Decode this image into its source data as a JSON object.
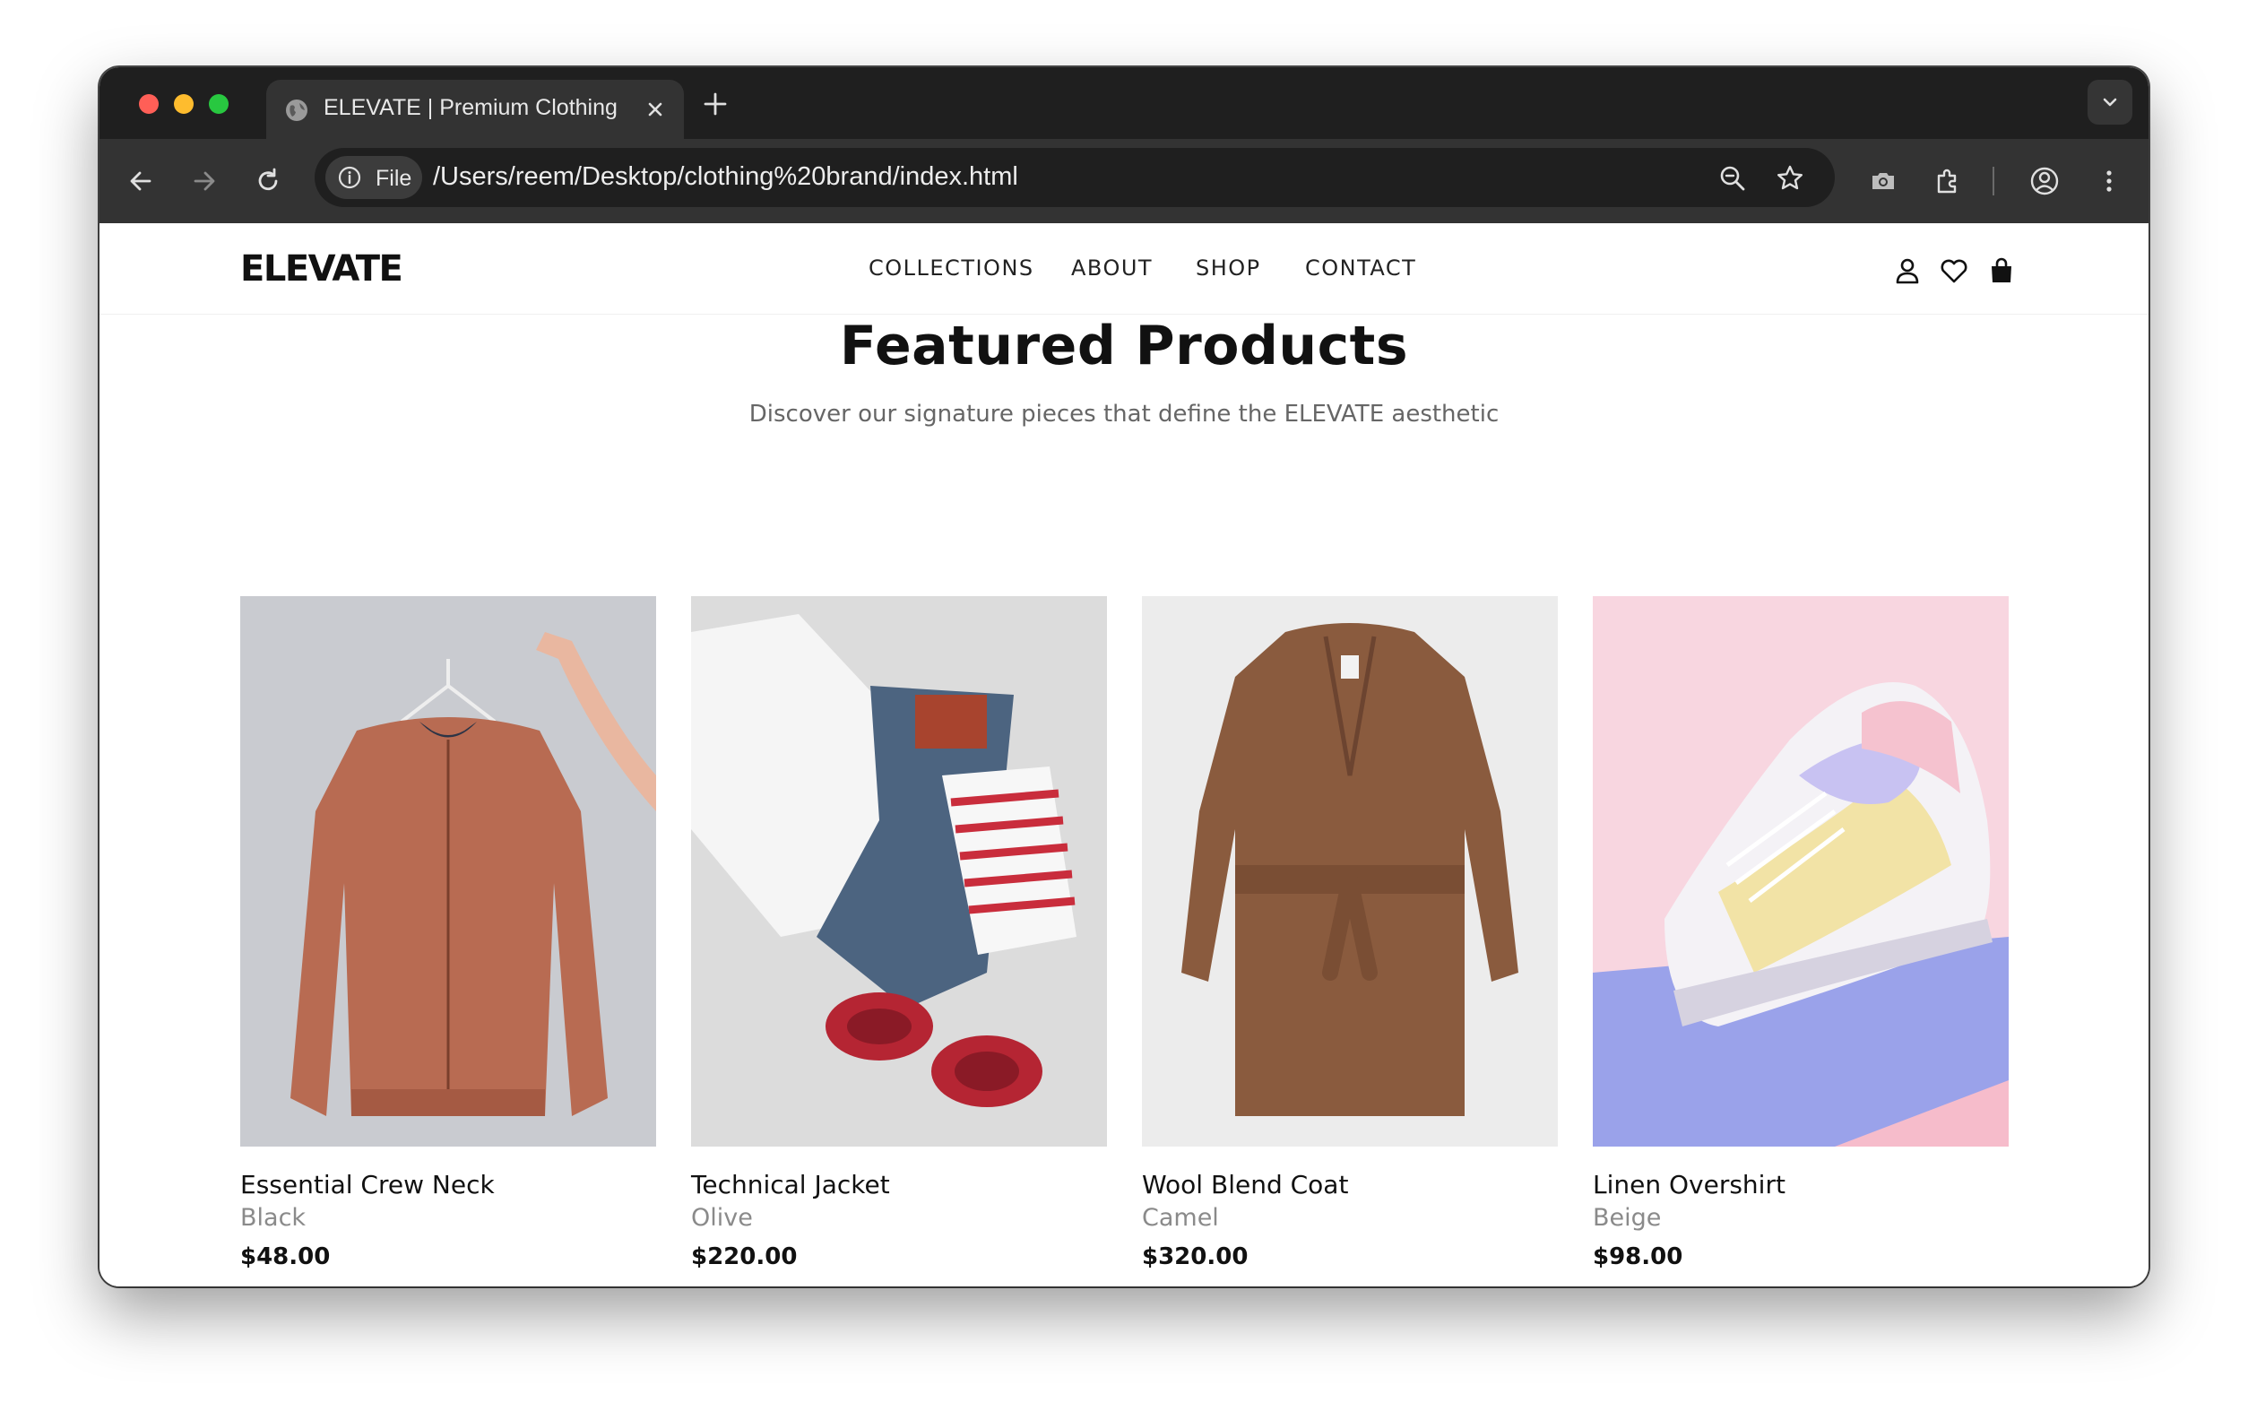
{
  "browser": {
    "tab": {
      "title": "ELEVATE | Premium Clothing",
      "favicon": "globe-icon"
    },
    "address_bar": {
      "scheme_label": "File",
      "url": "/Users/reem/Desktop/clothing%20brand/index.html"
    },
    "icons": [
      "back-icon",
      "forward-icon",
      "reload-icon",
      "info-icon",
      "zoom-icon",
      "star-icon",
      "camera-icon",
      "extensions-icon",
      "profile-icon",
      "more-icon"
    ]
  },
  "site": {
    "logo": "ELEVATE",
    "nav": [
      "COLLECTIONS",
      "ABOUT",
      "SHOP",
      "CONTACT"
    ],
    "header_icons": [
      "user-icon",
      "heart-icon",
      "shopping-bag-icon"
    ]
  },
  "featured": {
    "title": "Featured Products",
    "subtitle": "Discover our signature pieces that define the ELEVATE aesthetic",
    "products": [
      {
        "name": "Essential Crew Neck",
        "color": "Black",
        "price": "$48.00",
        "image": "rust bomber jacket on hanger"
      },
      {
        "name": "Technical Jacket",
        "color": "Olive",
        "price": "$220.00",
        "image": "flat lay of jeans, white shirt, striped top and red sandals"
      },
      {
        "name": "Wool Blend Coat",
        "color": "Camel",
        "price": "$320.00",
        "image": "brown belted wrap coat"
      },
      {
        "name": "Linen Overshirt",
        "color": "Beige",
        "price": "$98.00",
        "image": "pastel sneaker on pink and lilac backdrop"
      }
    ]
  },
  "colors": {
    "titlebar": "#1f1f1f",
    "toolbar": "#333333",
    "text_primary": "#111111",
    "text_muted": "#8a8a8a"
  }
}
